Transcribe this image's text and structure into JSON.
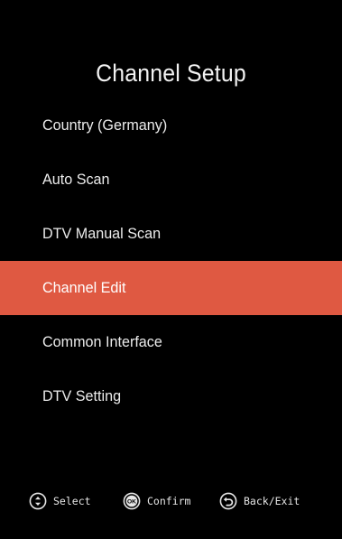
{
  "screen": {
    "title": "Channel Setup",
    "accent_color": "#df5942",
    "background_color": "#000000"
  },
  "menu": {
    "items": [
      {
        "label": "Country (Germany)",
        "selected": false
      },
      {
        "label": "Auto Scan",
        "selected": false
      },
      {
        "label": "DTV Manual Scan",
        "selected": false
      },
      {
        "label": "Channel Edit",
        "selected": true
      },
      {
        "label": "Common Interface",
        "selected": false
      },
      {
        "label": "DTV Setting",
        "selected": false
      }
    ]
  },
  "hints": {
    "select": {
      "icon": "up-down-icon",
      "label": "Select"
    },
    "confirm": {
      "icon": "ok-icon",
      "label": "Confirm",
      "icon_text": "OK"
    },
    "back": {
      "icon": "back-icon",
      "label": "Back/Exit"
    }
  }
}
